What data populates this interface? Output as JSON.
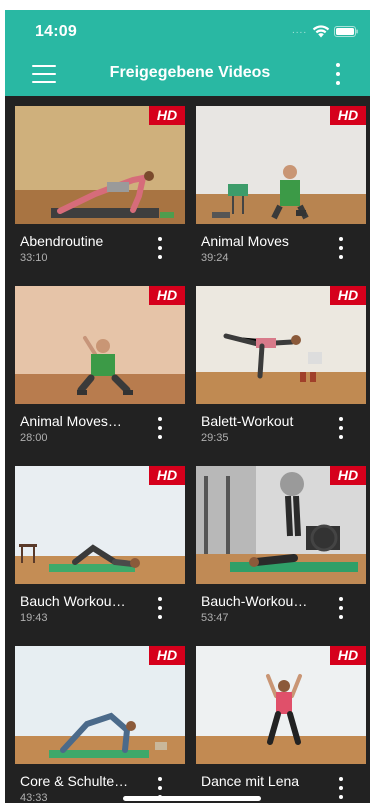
{
  "status_bar": {
    "time": "14:09",
    "dots": "....",
    "icons": [
      "wifi-icon",
      "battery-icon"
    ]
  },
  "header": {
    "title": "Freigegebene Videos",
    "left_icon": "menu-icon",
    "right_icon": "more-vertical-icon"
  },
  "badge_label": "HD",
  "colors": {
    "header": "#29b8a3",
    "background": "#222222",
    "badge": "#d6001c"
  },
  "videos": [
    {
      "title": "Abendroutine",
      "duration": "33:10"
    },
    {
      "title": "Animal Moves",
      "duration": "39:24"
    },
    {
      "title": "Animal Moves…",
      "duration": "28:00"
    },
    {
      "title": "Balett-Workout",
      "duration": "29:35"
    },
    {
      "title": "Bauch Workou…",
      "duration": "19:43"
    },
    {
      "title": "Bauch-Workou…",
      "duration": "53:47"
    },
    {
      "title": "Core & Schulte…",
      "duration": "43:33"
    },
    {
      "title": "Dance mit Lena",
      "duration": ""
    }
  ]
}
